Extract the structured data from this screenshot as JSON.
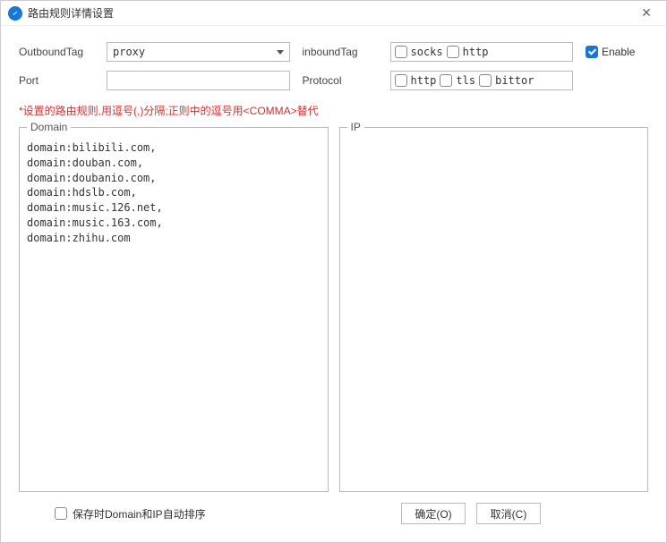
{
  "window": {
    "title": "路由规则详情设置"
  },
  "form": {
    "outboundTag": {
      "label": "OutboundTag",
      "value": "proxy"
    },
    "inboundTag": {
      "label": "inboundTag",
      "options": [
        {
          "label": "socks",
          "checked": false
        },
        {
          "label": "http",
          "checked": false
        }
      ]
    },
    "enable": {
      "label": "Enable",
      "checked": true
    },
    "port": {
      "label": "Port",
      "value": ""
    },
    "protocol": {
      "label": "Protocol",
      "options": [
        {
          "label": "http",
          "checked": false
        },
        {
          "label": "tls",
          "checked": false
        },
        {
          "label": "bittor",
          "checked": false
        }
      ]
    }
  },
  "hint": "*设置的路由规则,用逗号(,)分隔;正则中的逗号用<COMMA>替代",
  "panels": {
    "domain": {
      "title": "Domain",
      "value": "domain:bilibili.com,\ndomain:douban.com,\ndomain:doubanio.com,\ndomain:hdslb.com,\ndomain:music.126.net,\ndomain:music.163.com,\ndomain:zhihu.com"
    },
    "ip": {
      "title": "IP",
      "value": ""
    }
  },
  "footer": {
    "autoSort": {
      "label": "保存时Domain和IP自动排序",
      "checked": false
    },
    "ok": "确定(O)",
    "cancel": "取消(C)"
  }
}
